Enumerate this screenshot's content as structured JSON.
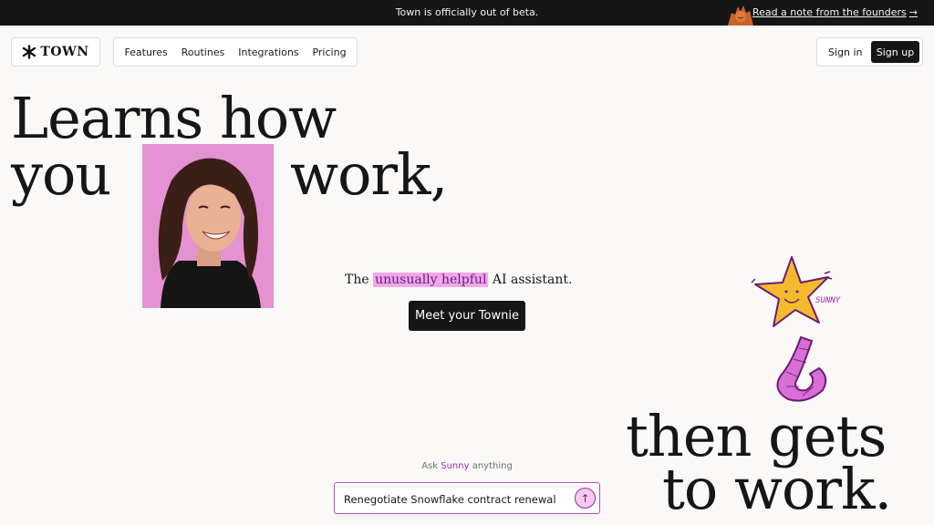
{
  "banner": {
    "message": "Town is officially out of beta.",
    "link_label": "Read a note from the founders",
    "link_arrow": "→"
  },
  "header": {
    "logo_text": "TOWN",
    "nav": [
      "Features",
      "Routines",
      "Integrations",
      "Pricing"
    ],
    "signin_label": "Sign in",
    "signup_label": "Sign up"
  },
  "hero": {
    "line1": "Learns how",
    "line2a": "you",
    "line2b": "work,",
    "line3": "then gets",
    "line4": "to work.",
    "tagline_pre": "The",
    "tagline_highlight": "unusually helpful",
    "tagline_post": "AI assistant.",
    "cta_label": "Meet your Townie",
    "mascot_label": "SUNNY"
  },
  "ask": {
    "prefix": "Ask",
    "name": "Sunny",
    "suffix": "anything",
    "input_value": "Renegotiate Snowflake contract renewal"
  },
  "colors": {
    "accent_pink": "#f2a6ea",
    "accent_purple": "#9a2fb0",
    "dark": "#161616",
    "background": "#faf9f7"
  },
  "icons": [
    "town-logo-icon",
    "arrow-right-icon",
    "arrow-up-icon",
    "star-mascot-icon",
    "founder-mascot-icon"
  ]
}
